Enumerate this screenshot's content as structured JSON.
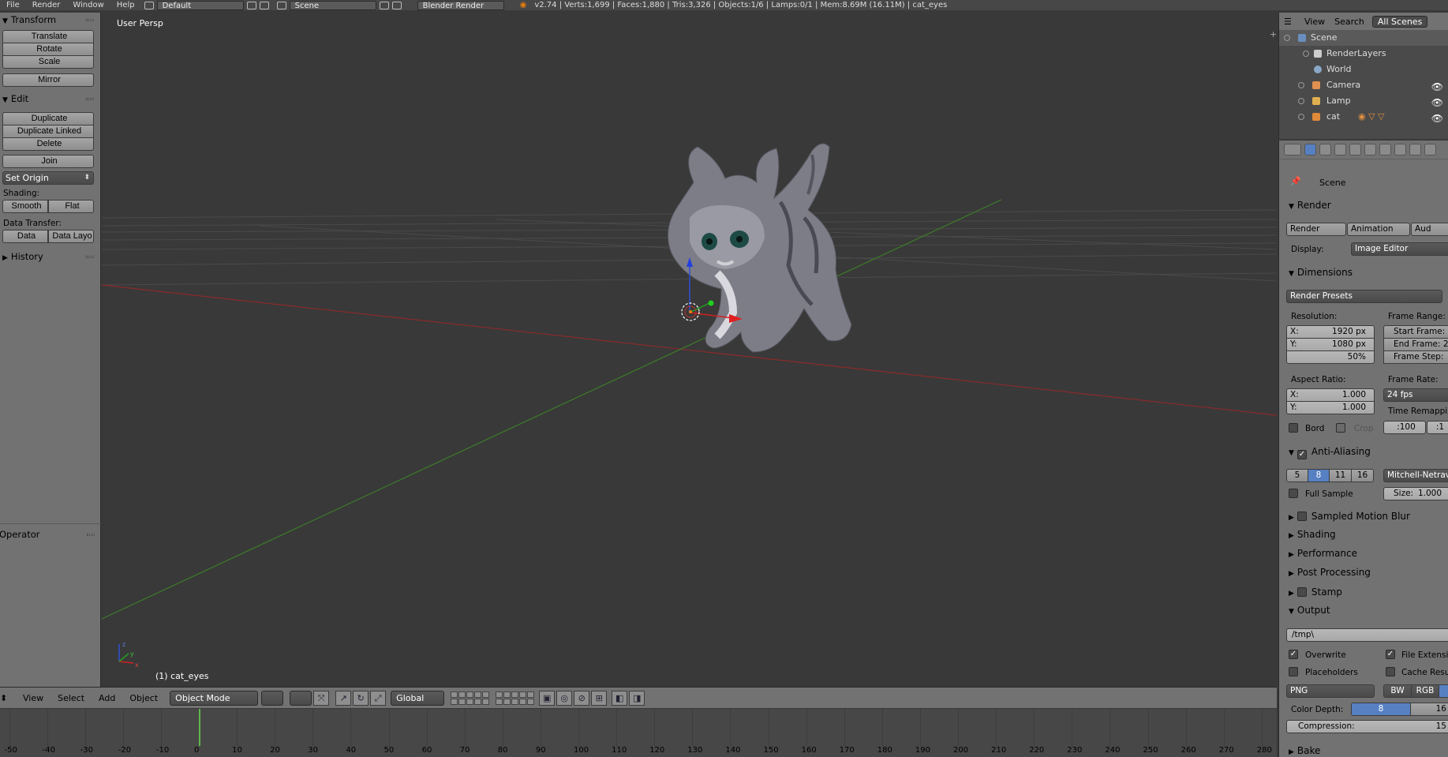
{
  "topbar": {
    "menus": [
      "File",
      "Render",
      "Window",
      "Help"
    ],
    "layout": "Default",
    "scene": "Scene",
    "engine": "Blender Render",
    "stats": "v2.74 | Verts:1,699 | Faces:1,880 | Tris:3,326 | Objects:1/6 | Lamps:0/1 | Mem:8.69M (16.11M) | cat_eyes"
  },
  "toolshelf": {
    "transform_title": "Transform",
    "translate": "Translate",
    "rotate": "Rotate",
    "scale": "Scale",
    "mirror": "Mirror",
    "edit_title": "Edit",
    "duplicate": "Duplicate",
    "duplicate_linked": "Duplicate Linked",
    "delete": "Delete",
    "join": "Join",
    "set_origin": "Set Origin",
    "shading_label": "Shading:",
    "smooth": "Smooth",
    "flat": "Flat",
    "data_transfer_label": "Data Transfer:",
    "data": "Data",
    "data_layo": "Data Layo",
    "history_title": "History",
    "operator_title": "Operator"
  },
  "viewport": {
    "persp_label": "User Persp",
    "object_label": "(1) cat_eyes",
    "axis_x": "x",
    "axis_y": "y",
    "axis_z": "z"
  },
  "v3dheader": {
    "view": "View",
    "select": "Select",
    "add": "Add",
    "object": "Object",
    "mode": "Object Mode",
    "orientation": "Global"
  },
  "timeline": {
    "ticks": [
      "-50",
      "-40",
      "-30",
      "-20",
      "-10",
      "0",
      "10",
      "20",
      "30",
      "40",
      "50",
      "60",
      "70",
      "80",
      "90",
      "100",
      "110",
      "120",
      "130",
      "140",
      "150",
      "160",
      "170",
      "180",
      "190",
      "200",
      "210",
      "220",
      "230",
      "240",
      "250",
      "260",
      "270",
      "280"
    ]
  },
  "outliner": {
    "view": "View",
    "search": "Search",
    "all_scenes": "All Scenes",
    "scene": "Scene",
    "renderlayers": "RenderLayers",
    "world": "World",
    "camera": "Camera",
    "lamp": "Lamp",
    "cat": "cat"
  },
  "properties": {
    "context": "Scene",
    "render_title": "Render",
    "render_btn": "Render",
    "animation_btn": "Animation",
    "audio_btn": "Aud",
    "display_label": "Display:",
    "display_value": "Image Editor",
    "dimensions_title": "Dimensions",
    "render_presets": "Render Presets",
    "resolution_label": "Resolution:",
    "res_x_label": "X:",
    "res_x": "1920 px",
    "res_y_label": "Y:",
    "res_y": "1080 px",
    "res_pct": "50%",
    "frame_range_label": "Frame Range:",
    "start_frame": "Start Frame:",
    "end_frame": "End Frame: 2",
    "frame_step": "Frame Step:",
    "aspect_label": "Aspect Ratio:",
    "aspect_x_label": "X:",
    "aspect_x": "1.000",
    "aspect_y_label": "Y:",
    "aspect_y": "1.000",
    "frame_rate_label": "Frame Rate:",
    "fps": "24 fps",
    "time_remap": "Time Remappin",
    "bord": "Bord",
    "crop": "Crop",
    "remap_old": ":100",
    "remap_new": ":1",
    "aa_title": "Anti-Aliasing",
    "aa_5": "5",
    "aa_8": "8",
    "aa_11": "11",
    "aa_16": "16",
    "aa_filter": "Mitchell-Netrav",
    "full_sample": "Full Sample",
    "size": "Size:",
    "size_val": "1.000",
    "motion_blur": "Sampled Motion Blur",
    "shading": "Shading",
    "performance": "Performance",
    "post_processing": "Post Processing",
    "stamp": "Stamp",
    "output_title": "Output",
    "output_path": "/tmp\\",
    "overwrite": "Overwrite",
    "file_ext": "File Extensi",
    "placeholders": "Placeholders",
    "cache_result": "Cache Resu",
    "format": "PNG",
    "bw": "BW",
    "rgb": "RGB",
    "color_depth_label": "Color Depth:",
    "depth_8": "8",
    "depth_16": "16",
    "compression": "Compression:",
    "compression_val": "15",
    "bake": "Bake"
  }
}
